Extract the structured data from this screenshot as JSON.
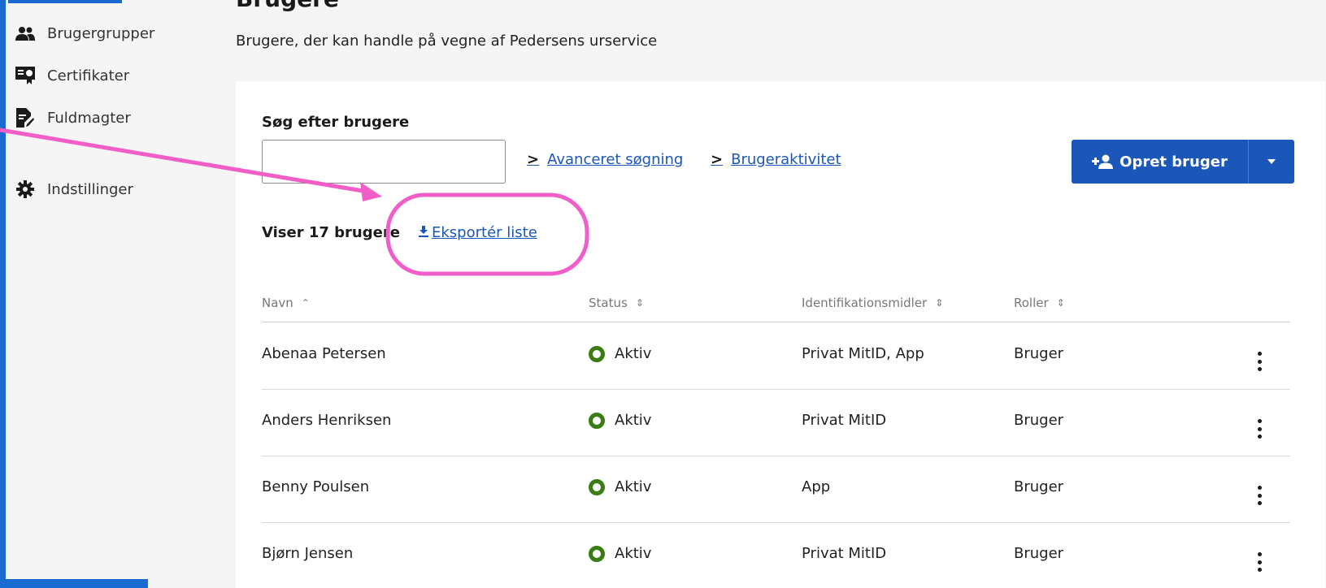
{
  "sidebar": {
    "items": [
      {
        "label": "Brugergrupper",
        "icon": "users-icon"
      },
      {
        "label": "Certifikater",
        "icon": "certificate-icon"
      },
      {
        "label": "Fuldmagter",
        "icon": "signed-document-icon"
      },
      {
        "label": "Indstillinger",
        "icon": "gear-icon"
      }
    ]
  },
  "header": {
    "title": "Brugere",
    "subtitle": "Brugere, der kan handle på vegne af Pedersens urservice"
  },
  "search": {
    "label": "Søg efter brugere",
    "value": "",
    "placeholder": ""
  },
  "links": {
    "advanced": "Avanceret søgning",
    "activity": "Brugeraktivitet",
    "export": "Eksportér liste"
  },
  "actions": {
    "create_user": "Opret bruger"
  },
  "list": {
    "count_text": "Viser 17 brugere"
  },
  "table": {
    "columns": [
      "Navn",
      "Status",
      "Identifikationsmidler",
      "Roller"
    ],
    "rows": [
      {
        "name": "Abenaa Petersen",
        "status": "Aktiv",
        "ids": "Privat MitID, App",
        "role": "Bruger"
      },
      {
        "name": "Anders Henriksen",
        "status": "Aktiv",
        "ids": "Privat MitID",
        "role": "Bruger"
      },
      {
        "name": "Benny Poulsen",
        "status": "Aktiv",
        "ids": "App",
        "role": "Bruger"
      },
      {
        "name": "Bjørn Jensen",
        "status": "Aktiv",
        "ids": "Privat MitID",
        "role": "Bruger"
      }
    ]
  },
  "colors": {
    "primary": "#1a57b8",
    "status_active": "#3a7d15",
    "annotation": "#f25ec8",
    "frame": "#1a6bd1"
  }
}
